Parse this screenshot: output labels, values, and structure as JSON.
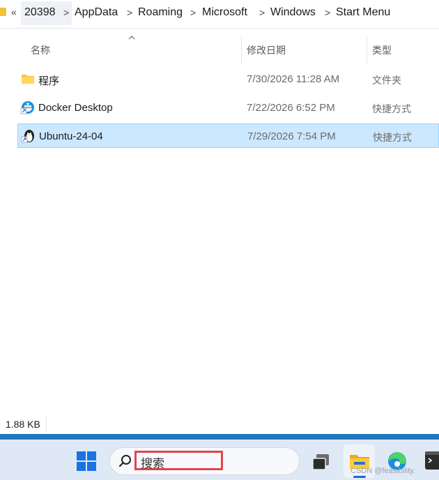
{
  "breadcrumb": {
    "overflow": "«",
    "items": [
      "20398",
      "AppData",
      "Roaming",
      "Microsoft",
      "Windows",
      "Start Menu"
    ],
    "separator": ">"
  },
  "columns": {
    "name": "名称",
    "date": "修改日期",
    "type": "类型"
  },
  "files": [
    {
      "name": "程序",
      "date": "7/30/2026 11:28 AM",
      "type": "文件夹",
      "icon": "folder-icon",
      "selected": false
    },
    {
      "name": "Docker Desktop",
      "date": "7/22/2026 6:52 PM",
      "type": "快捷方式",
      "icon": "docker-shortcut-icon",
      "selected": false
    },
    {
      "name": "Ubuntu-24-04",
      "date": "7/29/2026 7:54 PM",
      "type": "快捷方式",
      "icon": "ubuntu-shortcut-icon",
      "selected": true
    }
  ],
  "status": {
    "size": "1.88 KB"
  },
  "taskbar": {
    "search_placeholder": "搜索",
    "watermark": "CSDN @feasibility."
  },
  "colors": {
    "selection": "#cce8ff",
    "selection_border": "#99d1ff",
    "highlight": "#e0454b",
    "folder": "#f2c232"
  }
}
